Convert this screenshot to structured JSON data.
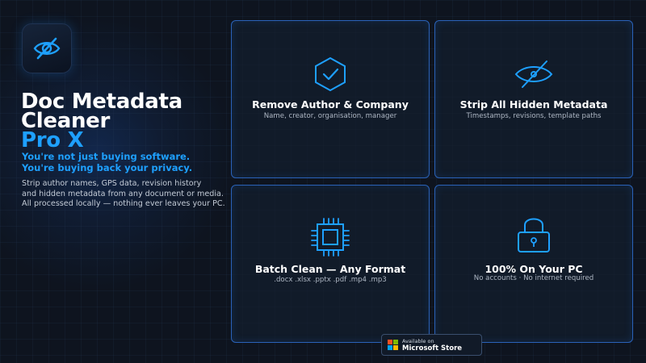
{
  "app": {
    "icon": "eye-slash-icon",
    "title_lines": [
      "Doc Metadata",
      "Cleaner"
    ],
    "title_accent": "Pro X",
    "tagline": [
      "You're not just buying software.",
      "You're buying back your privacy."
    ],
    "description": [
      "Strip author names, GPS data, revision history",
      "and hidden metadata from any document or media.",
      "All processed locally — nothing ever leaves your PC."
    ]
  },
  "features": [
    {
      "icon": "shield-check-icon",
      "title": "Remove Author & Company",
      "subtitle": "Name, creator, organisation, manager"
    },
    {
      "icon": "eye-slash-icon",
      "title": "Strip All Hidden Metadata",
      "subtitle": "Timestamps, revisions, template paths"
    },
    {
      "icon": "cpu-chip-icon",
      "title": "Batch Clean — Any Format",
      "subtitle": ".docx .xlsx .pptx .pdf .mp4 .mp3"
    },
    {
      "icon": "padlock-icon",
      "title": "100% On Your PC",
      "subtitle": "No accounts · No internet required"
    }
  ],
  "store_badge": {
    "small": "Available on",
    "big": "Microsoft Store",
    "icon": "microsoft-logo-icon"
  },
  "colors": {
    "accent": "#1ea0ff",
    "background": "#0e141f",
    "card_border": "#2a62b8",
    "ms_red": "#f25022",
    "ms_green": "#7fba00",
    "ms_blue": "#00a4ef",
    "ms_yellow": "#ffb900"
  }
}
